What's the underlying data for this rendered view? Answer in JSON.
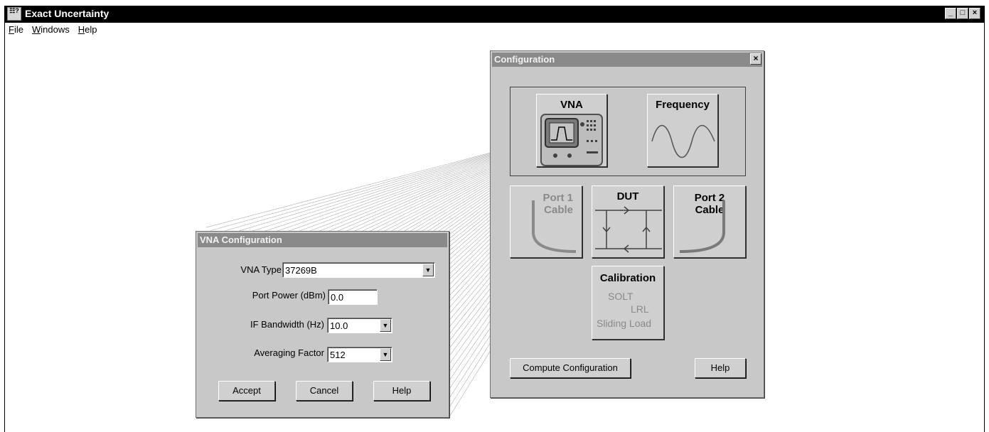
{
  "app": {
    "title": "Exact Uncertainty",
    "icon_text": "☷?",
    "controls": {
      "minimize": "_",
      "maximize": "□",
      "close": "×"
    }
  },
  "menu": [
    {
      "label": "File"
    },
    {
      "label": "Windows"
    },
    {
      "label": "Help"
    }
  ],
  "config_window": {
    "title": "Configuration",
    "close": "×",
    "tiles": {
      "vna": "VNA",
      "frequency": "Frequency",
      "port1": "Port 1\nCable",
      "dut": "DUT",
      "port2": "Port 2\nCable",
      "calibration": "Calibration"
    },
    "calibration_options": [
      "SOLT",
      "LRL",
      "Sliding Load"
    ],
    "compute_button": "Compute Configuration",
    "help_button": "Help"
  },
  "vna_dialog": {
    "title": "VNA Configuration",
    "vna_type_label": "VNA Type",
    "vna_type_value": "37269B",
    "port_power_label": "Port Power (dBm)",
    "port_power_value": "0.0",
    "if_bandwidth_label": "IF Bandwidth (Hz)",
    "if_bandwidth_value": "10.0",
    "averaging_label": "Averaging Factor",
    "averaging_value": "512",
    "accept_button": "Accept",
    "cancel_button": "Cancel",
    "help_button": "Help"
  },
  "colors": {
    "titlebar": "#000000",
    "dialog_bg": "#c8c8c8",
    "dialog_title": "#8a8a8a",
    "dim_text": "#8a8a8a"
  }
}
